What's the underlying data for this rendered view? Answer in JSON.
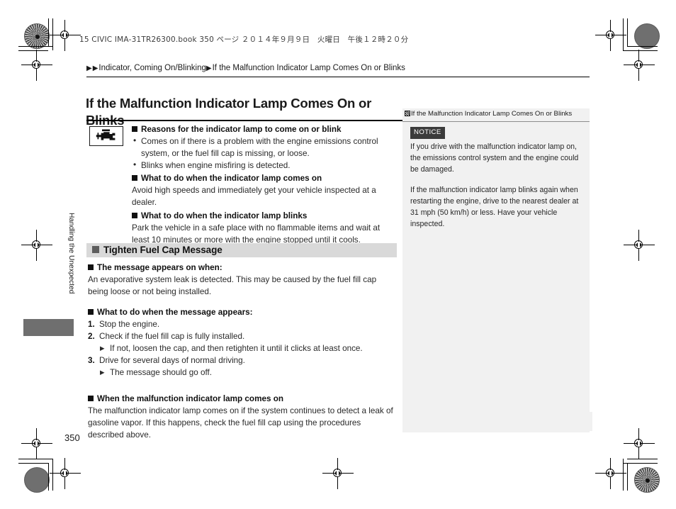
{
  "slug": {
    "text": "15 CIVIC IMA-31TR26300.book   350 ページ   ２０１４年９月９日　火曜日　午後１２時２０分"
  },
  "breadcrumb": {
    "arrow": "▶",
    "level1": "Indicator, Coming On/Blinking",
    "level2": "If the Malfunction Indicator Lamp Comes On or Blinks"
  },
  "title": "If the Malfunction Indicator Lamp Comes On or Blinks",
  "icon": {
    "name": "check-engine-icon"
  },
  "main": {
    "heading1": "Reasons for the indicator lamp to come on or blink",
    "bullets1": [
      "Comes on if there is a problem with the engine emissions control system, or the fuel fill cap is missing, or loose.",
      "Blinks when engine misfiring is detected."
    ],
    "heading2": "What to do when the indicator lamp comes on",
    "para2": "Avoid high speeds and immediately get your vehicle inspected at a dealer.",
    "heading3": "What to do when the indicator lamp blinks",
    "para3": "Park the vehicle in a safe place with no flammable items and wait at least 10 minutes or more with the engine stopped until it cools."
  },
  "section": {
    "title": "Tighten Fuel Cap Message",
    "heading1": "The message appears on when:",
    "para1": "An evaporative system leak is detected. This may be caused by the fuel fill cap being loose or not being installed.",
    "heading2": "What to do when the message appears:",
    "steps": [
      {
        "num": "1.",
        "text": "Stop the engine."
      },
      {
        "num": "2.",
        "text": "Check if the fuel fill cap is fully installed.",
        "sub": "If not, loosen the cap, and then retighten it until it clicks at least once."
      },
      {
        "num": "3.",
        "text": "Drive for several days of normal driving.",
        "sub": "The message should go off."
      }
    ],
    "heading3": "When the malfunction indicator lamp comes on",
    "para3": "The malfunction indicator lamp comes on if the system continues to detect a leak of gasoline vapor. If this happens, check the fuel fill cap using the procedures described above."
  },
  "sidebar": {
    "header": "If the Malfunction Indicator Lamp Comes On or Blinks",
    "notice_label": "NOTICE",
    "paragraph1": "If you drive with the malfunction indicator lamp on, the emissions control system and the engine could be damaged.",
    "paragraph2": "If the malfunction indicator lamp blinks again when restarting the engine, drive to the nearest dealer at 31 mph (50 km/h) or less. Have your vehicle inspected."
  },
  "side_tab": {
    "label": "Handling the Unexpected"
  },
  "folio": "350",
  "colors": {
    "section_bar": "#d9d9d9",
    "panel_bg": "#f1f1f1",
    "notice_bg": "#3b3b3b",
    "tab_block": "#6f6f6f"
  }
}
